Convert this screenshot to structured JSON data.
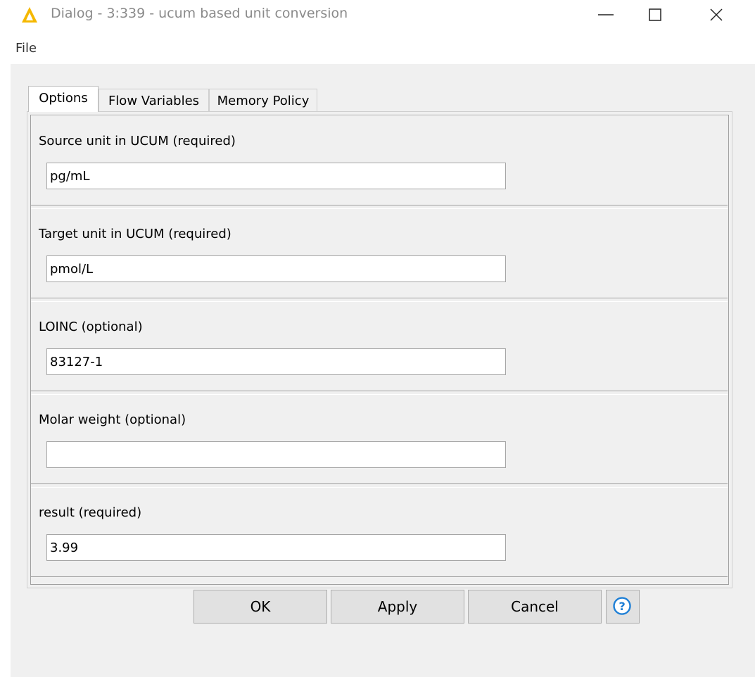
{
  "window": {
    "title": "Dialog - 3:339 - ucum based unit conversion"
  },
  "menu": {
    "file": "File"
  },
  "tabs": [
    {
      "label": "Options",
      "active": true
    },
    {
      "label": "Flow Variables",
      "active": false
    },
    {
      "label": "Memory Policy",
      "active": false
    }
  ],
  "fields": [
    {
      "label": "Source unit in UCUM  (required)",
      "value": "pg/mL"
    },
    {
      "label": "Target unit in UCUM (required)",
      "value": "pmol/L"
    },
    {
      "label": "LOINC (optional)",
      "value": "83127-1"
    },
    {
      "label": "Molar weight (optional)",
      "value": ""
    },
    {
      "label": "result  (required)",
      "value": "3.99"
    }
  ],
  "buttons": {
    "ok": "OK",
    "apply": "Apply",
    "cancel": "Cancel",
    "help_icon": "help-question-icon"
  },
  "colors": {
    "title_icon": "#f5b800",
    "help_icon": "#1e7fd6"
  }
}
